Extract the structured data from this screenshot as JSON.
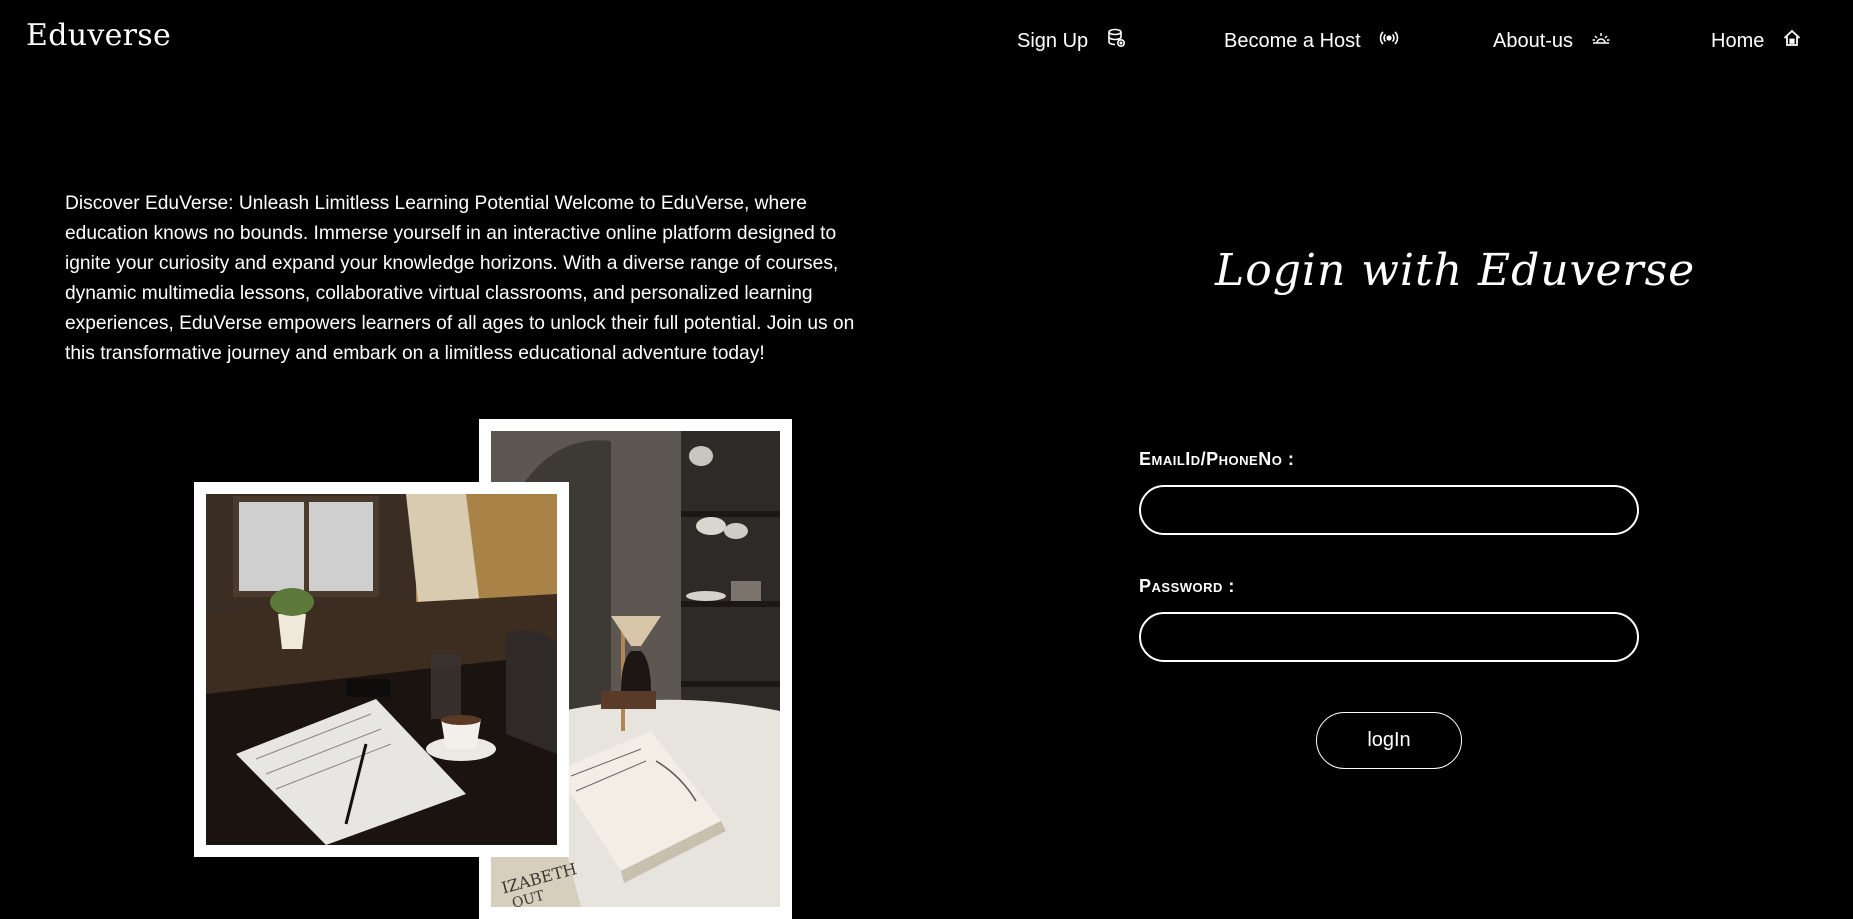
{
  "header": {
    "logo": "Eduverse",
    "nav": [
      {
        "label": "Sign Up",
        "icon": "database-icon"
      },
      {
        "label": "Become a Host",
        "icon": "broadcast-icon"
      },
      {
        "label": "About-us",
        "icon": "sunrise-icon"
      },
      {
        "label": "Home",
        "icon": "home-icon"
      }
    ]
  },
  "intro": {
    "text": "Discover EduVerse: Unleash Limitless Learning Potential Welcome to EduVerse, where education knows no bounds. Immerse yourself in an interactive online platform designed to ignite your curiosity and expand your knowledge horizons. With a diverse range of courses, dynamic multimedia lessons, collaborative virtual classrooms, and personalized learning experiences, EduVerse empowers learners of all ages to unlock their full potential. Join us on this transformative journey and embark on a limitless educational adventure today!"
  },
  "photos": [
    {
      "name": "desk-coffee-photo"
    },
    {
      "name": "coffee-book-table-photo",
      "book_text": "IZABETH\nOUT"
    }
  ],
  "login": {
    "title": "Login with Eduverse",
    "email_label": "EmailId/PhoneNo :",
    "email_value": "",
    "password_label": "Password :",
    "password_value": "",
    "button_label": "logIn"
  },
  "colors": {
    "background": "#000000",
    "text": "#ffffff",
    "frame": "#ffffff"
  }
}
